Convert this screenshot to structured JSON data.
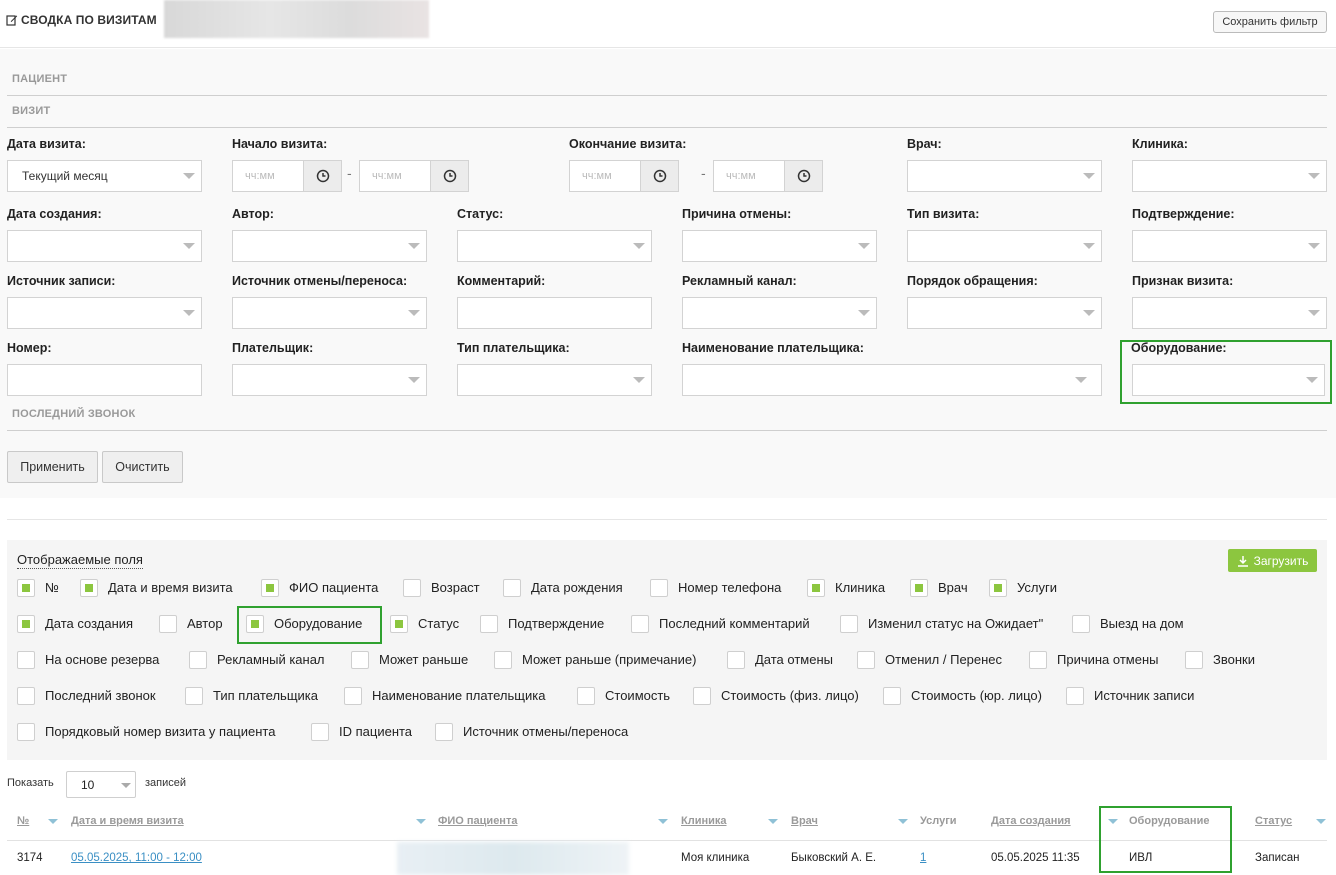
{
  "header": {
    "title": "СВОДКА ПО ВИЗИТАМ",
    "save_filter": "Сохранить фильтр"
  },
  "filters": {
    "section_patient": "ПАЦИЕНТ",
    "section_visit": "ВИЗИТ",
    "section_last_call": "ПОСЛЕДНИЙ ЗВОНОК",
    "visit_date_label": "Дата визита:",
    "visit_date_value": "Текущий месяц",
    "visit_start_label": "Начало визита:",
    "visit_end_label": "Окончание визита:",
    "time_placeholder": "чч:мм",
    "doctor_label": "Врач:",
    "clinic_label": "Клиника:",
    "created_label": "Дата создания:",
    "author_label": "Автор:",
    "status_label": "Статус:",
    "cancel_reason_label": "Причина отмены:",
    "visit_type_label": "Тип визита:",
    "confirmation_label": "Подтверждение:",
    "record_source_label": "Источник записи:",
    "cancel_source_label": "Источник отмены/переноса:",
    "comment_label": "Комментарий:",
    "ad_channel_label": "Рекламный канал:",
    "appeal_order_label": "Порядок обращения:",
    "visit_sign_label": "Признак визита:",
    "number_label": "Номер:",
    "payer_label": "Плательщик:",
    "payer_type_label": "Тип плательщика:",
    "payer_name_label": "Наименование плательщика:",
    "equipment_label": "Оборудование:",
    "apply": "Применить",
    "clear": "Очистить"
  },
  "fields": {
    "title": "Отображаемые поля",
    "download": "Загрузить",
    "items": [
      {
        "label": "№",
        "checked": true
      },
      {
        "label": "Дата и время визита",
        "checked": true
      },
      {
        "label": "ФИО пациента",
        "checked": true
      },
      {
        "label": "Возраст",
        "checked": false
      },
      {
        "label": "Дата рождения",
        "checked": false
      },
      {
        "label": "Номер телефона",
        "checked": false
      },
      {
        "label": "Клиника",
        "checked": true
      },
      {
        "label": "Врач",
        "checked": true
      },
      {
        "label": "Услуги",
        "checked": true
      },
      {
        "label": "Дата создания",
        "checked": true
      },
      {
        "label": "Автор",
        "checked": false
      },
      {
        "label": "Оборудование",
        "checked": true
      },
      {
        "label": "Статус",
        "checked": true
      },
      {
        "label": "Подтверждение",
        "checked": false
      },
      {
        "label": "Последний комментарий",
        "checked": false
      },
      {
        "label": "Изменил статус на Ожидает\"",
        "checked": false
      },
      {
        "label": "Выезд на дом",
        "checked": false
      },
      {
        "label": "На основе резерва",
        "checked": false
      },
      {
        "label": "Рекламный канал",
        "checked": false
      },
      {
        "label": "Может раньше",
        "checked": false
      },
      {
        "label": "Может раньше (примечание)",
        "checked": false
      },
      {
        "label": "Дата отмены",
        "checked": false
      },
      {
        "label": "Отменил / Перенес",
        "checked": false
      },
      {
        "label": "Причина отмены",
        "checked": false
      },
      {
        "label": "Звонки",
        "checked": false
      },
      {
        "label": "Последний звонок",
        "checked": false
      },
      {
        "label": "Тип плательщика",
        "checked": false
      },
      {
        "label": "Наименование плательщика",
        "checked": false
      },
      {
        "label": "Стоимость",
        "checked": false
      },
      {
        "label": "Стоимость (физ. лицо)",
        "checked": false
      },
      {
        "label": "Стоимость (юр. лицо)",
        "checked": false
      },
      {
        "label": "Источник записи",
        "checked": false
      },
      {
        "label": "Порядковый номер визита у пациента",
        "checked": false
      },
      {
        "label": "ID пациента",
        "checked": false
      },
      {
        "label": "Источник отмены/переноса",
        "checked": false
      }
    ]
  },
  "pagination": {
    "show": "Показать",
    "count": "10",
    "records": "записей"
  },
  "table": {
    "headers": {
      "num": "№",
      "datetime": "Дата и время визита",
      "patient": "ФИО пациента",
      "clinic": "Клиника",
      "doctor": "Врач",
      "services": "Услуги",
      "created": "Дата создания",
      "equipment": "Оборудование",
      "status": "Статус"
    },
    "row": {
      "num": "3174",
      "datetime": "05.05.2025, 11:00 - 12:00",
      "clinic": "Моя клиника",
      "doctor": "Быковский А. Е.",
      "services": "1",
      "created": "05.05.2025 11:35",
      "equipment": "ИВЛ",
      "status": "Записан"
    }
  }
}
